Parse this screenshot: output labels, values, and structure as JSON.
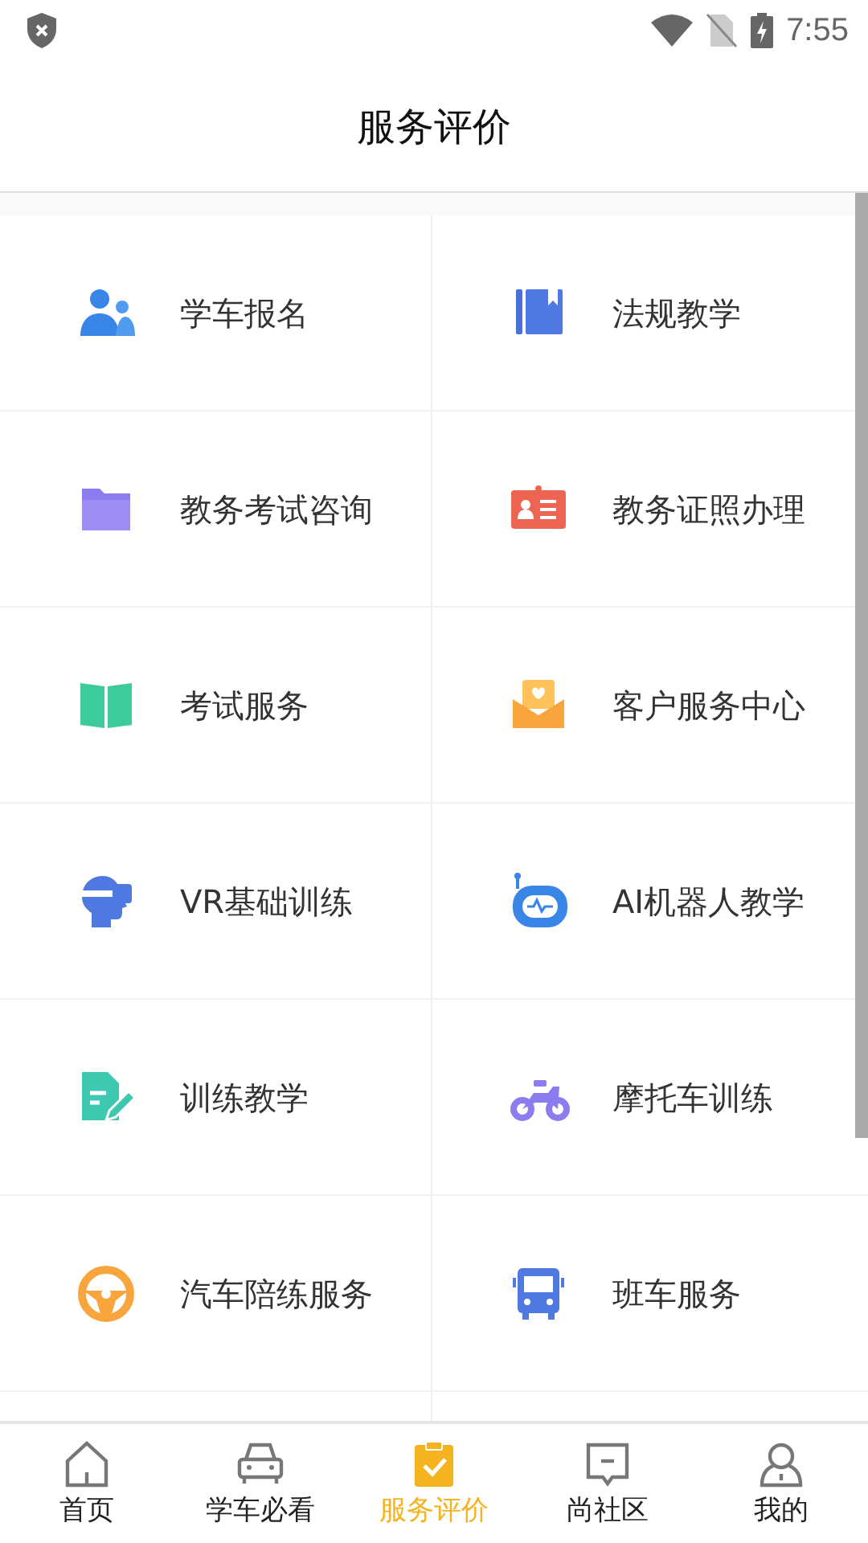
{
  "status_bar": {
    "time": "7:55"
  },
  "header": {
    "title": "服务评价"
  },
  "services": [
    {
      "label": "学车报名"
    },
    {
      "label": "法规教学"
    },
    {
      "label": "教务考试咨询"
    },
    {
      "label": "教务证照办理"
    },
    {
      "label": "考试服务"
    },
    {
      "label": "客户服务中心"
    },
    {
      "label": "VR基础训练"
    },
    {
      "label": "AI机器人教学"
    },
    {
      "label": "训练教学"
    },
    {
      "label": "摩托车训练"
    },
    {
      "label": "汽车陪练服务"
    },
    {
      "label": "班车服务"
    }
  ],
  "tabs": [
    {
      "label": "首页",
      "selected": false
    },
    {
      "label": "学车必看",
      "selected": false
    },
    {
      "label": "服务评价",
      "selected": true
    },
    {
      "label": "尚社区",
      "selected": false
    },
    {
      "label": "我的",
      "selected": false
    }
  ]
}
